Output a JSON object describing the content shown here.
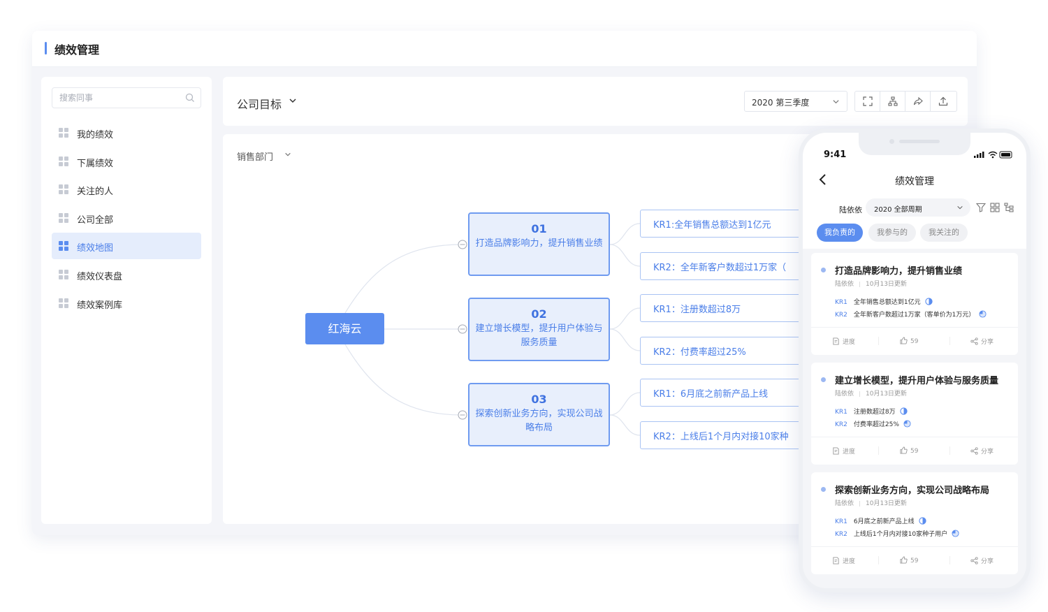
{
  "app": {
    "title": "绩效管理"
  },
  "sidebar": {
    "search_placeholder": "搜索同事",
    "items": [
      {
        "label": "我的绩效",
        "active": false
      },
      {
        "label": "下属绩效",
        "active": false
      },
      {
        "label": "关注的人",
        "active": false
      },
      {
        "label": "公司全部",
        "active": false
      },
      {
        "label": "绩效地图",
        "active": true
      },
      {
        "label": "绩效仪表盘",
        "active": false
      },
      {
        "label": "绩效案例库",
        "active": false
      }
    ]
  },
  "header": {
    "goal_label": "公司目标",
    "period": "2020 第三季度"
  },
  "map": {
    "department": "销售部门",
    "root": "红海云",
    "objectives": [
      {
        "num": "01",
        "text": "打造品牌影响力，提升销售业绩",
        "krs": [
          "KR1:全年销售总额达到1亿元",
          "KR2：全年新客户数超过1万家（"
        ]
      },
      {
        "num": "02",
        "text": "建立增长模型，提升用户体验与服务质量",
        "krs": [
          "KR1：注册数超过8万",
          "KR2：付费率超过25%"
        ]
      },
      {
        "num": "03",
        "text": "探索创新业务方向，实现公司战略布局",
        "krs": [
          "KR1：6月底之前新产品上线",
          "KR2：上线后1个月内对接10家种"
        ]
      }
    ]
  },
  "phone": {
    "time": "9:41",
    "title": "绩效管理",
    "user": "陆依依",
    "period": "2020 全部周期",
    "tabs": [
      "我负责的",
      "我参与的",
      "我关注的"
    ],
    "cards": [
      {
        "title": "打造品牌影响力，提升销售业绩",
        "owner": "陆依依",
        "updated": "10月13日更新",
        "krs": [
          {
            "tag": "KR1",
            "text": "全年销售总额达到1亿元"
          },
          {
            "tag": "KR2",
            "text": "全年新客户数超过1万家（客单价为1万元）"
          }
        ],
        "progress_label": "进度",
        "likes": "59",
        "share_label": "分享"
      },
      {
        "title": "建立增长模型，提升用户体验与服务质量",
        "owner": "陆依依",
        "updated": "10月13日更新",
        "krs": [
          {
            "tag": "KR1",
            "text": "注册数超过8万"
          },
          {
            "tag": "KR2",
            "text": "付费率超过25%"
          }
        ],
        "progress_label": "进度",
        "likes": "59",
        "share_label": "分享"
      },
      {
        "title": "探索创新业务方向，实现公司战略布局",
        "owner": "陆依依",
        "updated": "10月13日更新",
        "krs": [
          {
            "tag": "KR1",
            "text": "6月底之前新产品上线"
          },
          {
            "tag": "KR2",
            "text": "上线后1个月内对接10家种子用户"
          }
        ],
        "progress_label": "进度",
        "likes": "59",
        "share_label": "分享"
      }
    ]
  },
  "colors": {
    "accent": "#5b8def",
    "accent_text": "#4a7ee8",
    "node_fill": "#e8effc"
  }
}
